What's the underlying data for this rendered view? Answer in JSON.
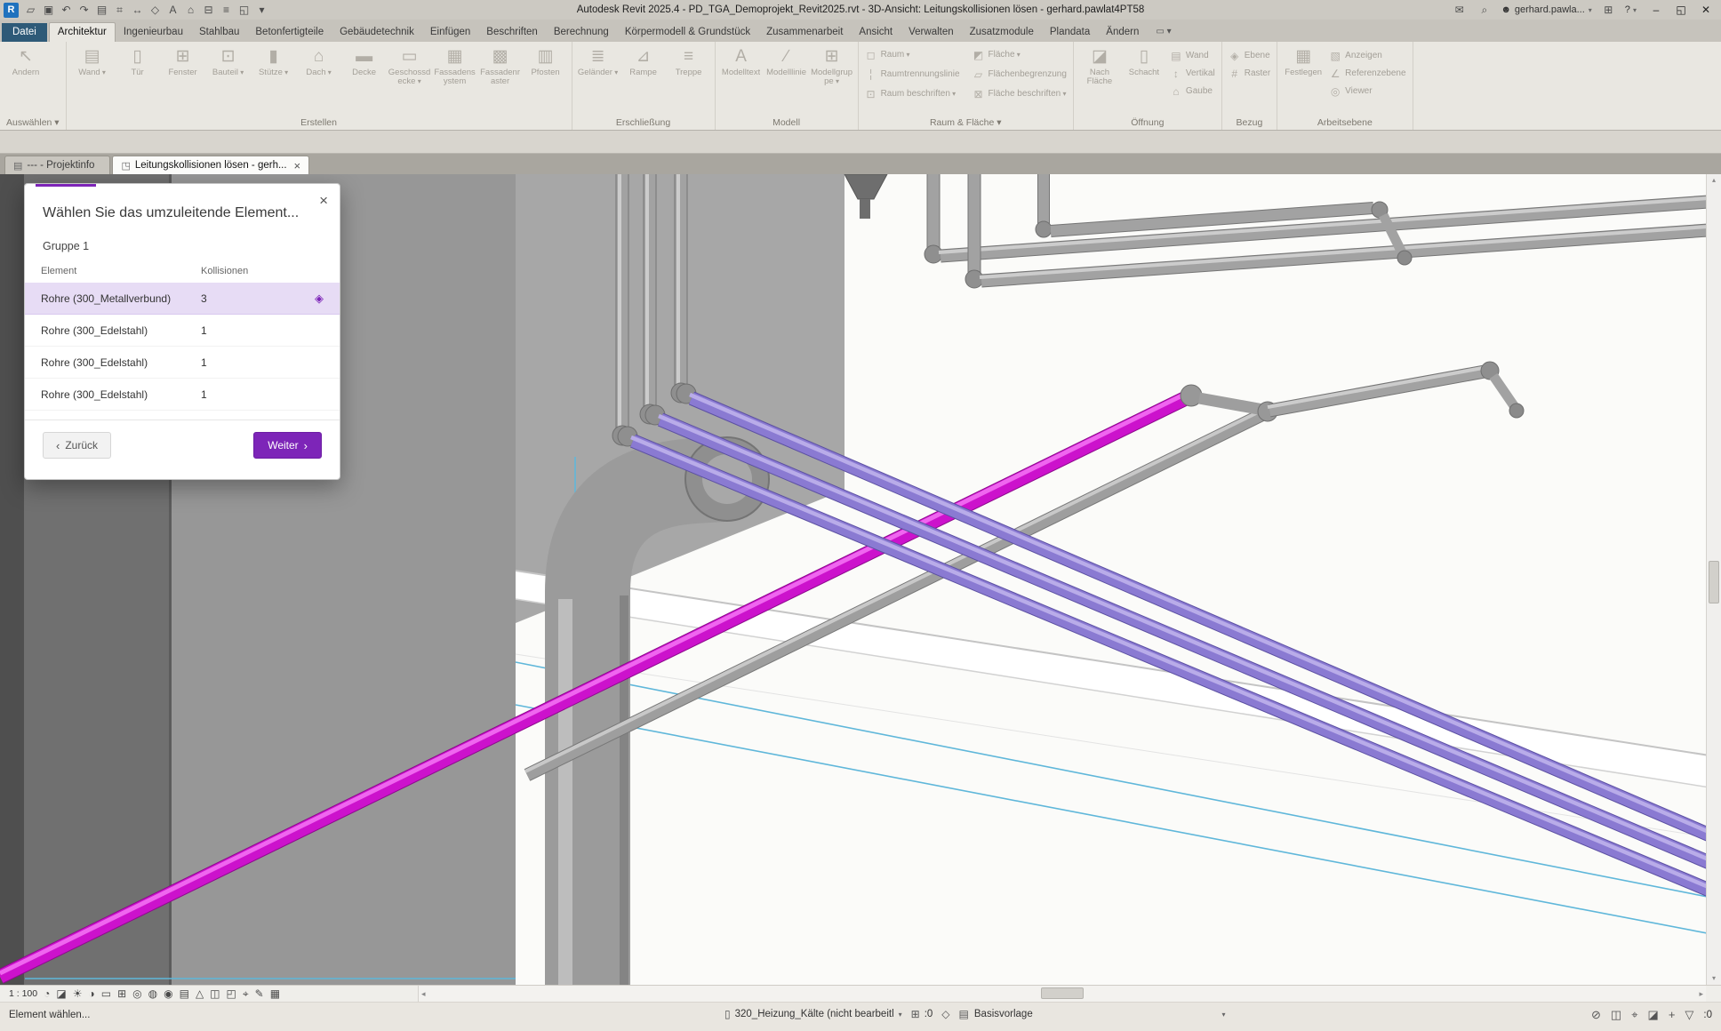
{
  "titlebar": {
    "logo_letter": "R",
    "title": "Autodesk Revit 2025.4 - PD_TGA_Demoprojekt_Revit2025.rvt - 3D-Ansicht: Leitungskollisionen lösen - gerhard.pawlat4PT58",
    "qat": [
      {
        "name": "open-icon",
        "glyph": "▱"
      },
      {
        "name": "save-icon",
        "glyph": "▣"
      },
      {
        "name": "undo-icon",
        "glyph": "↶"
      },
      {
        "name": "redo-icon",
        "glyph": "↷"
      },
      {
        "name": "print-icon",
        "glyph": "▤"
      },
      {
        "name": "measure-icon",
        "glyph": "⌗"
      },
      {
        "name": "aligned-dimension-icon",
        "glyph": "↔"
      },
      {
        "name": "tag-icon",
        "glyph": "◇"
      },
      {
        "name": "text-note-icon",
        "glyph": "A"
      },
      {
        "name": "default-3d-view-icon",
        "glyph": "⌂"
      },
      {
        "name": "section-icon",
        "glyph": "⊟"
      },
      {
        "name": "thin-lines-icon",
        "glyph": "≡"
      },
      {
        "name": "switch-windows-icon",
        "glyph": "◱"
      },
      {
        "name": "customize-qat-icon",
        "glyph": "▾"
      }
    ],
    "mail_glyph": "✉",
    "search_glyph": "⌕",
    "user_glyph": "☻",
    "user_label": "gerhard.pawla...",
    "cart_glyph": "⊞",
    "help_label": "?",
    "dropdown_glyph": "▾",
    "min_glyph": "–",
    "restore_glyph": "◱",
    "close_glyph": "✕"
  },
  "ribbon": {
    "tabs": [
      {
        "label": "Datei",
        "file": true
      },
      {
        "label": "Architektur",
        "active": true
      },
      {
        "label": "Ingenieurbau"
      },
      {
        "label": "Stahlbau"
      },
      {
        "label": "Betonfertigteile"
      },
      {
        "label": "Gebäudetechnik"
      },
      {
        "label": "Einfügen"
      },
      {
        "label": "Beschriften"
      },
      {
        "label": "Berechnung"
      },
      {
        "label": "Körpermodell & Grundstück"
      },
      {
        "label": "Zusammenarbeit"
      },
      {
        "label": "Ansicht"
      },
      {
        "label": "Verwalten"
      },
      {
        "label": "Zusatzmodule"
      },
      {
        "label": "Plandata"
      },
      {
        "label": "Ändern"
      }
    ],
    "toggle_glyph": "▭ ▾",
    "panels": {
      "auswaehlen": {
        "label": "Auswählen ▾",
        "button": {
          "label": "Ändern",
          "glyph": "↖"
        }
      },
      "erstellen": {
        "label": "Erstellen",
        "buttons": [
          {
            "label": "Wand",
            "glyph": "▤",
            "arrow": true
          },
          {
            "label": "Tür",
            "glyph": "▯"
          },
          {
            "label": "Fenster",
            "glyph": "⊞"
          },
          {
            "label": "Bauteil",
            "glyph": "⊡",
            "arrow": true
          },
          {
            "label": "Stütze",
            "glyph": "▮",
            "arrow": true
          },
          {
            "label": "Dach",
            "glyph": "⌂",
            "arrow": true
          },
          {
            "label": "Decke",
            "glyph": "▬"
          },
          {
            "label": "Geschossdecke",
            "glyph": "▭",
            "arrow": true
          },
          {
            "label": "Fassadensystem",
            "glyph": "▦"
          },
          {
            "label": "Fassadenraster",
            "glyph": "▩"
          },
          {
            "label": "Pfosten",
            "glyph": "▥"
          }
        ]
      },
      "erschliessung": {
        "label": "Erschließung",
        "buttons": [
          {
            "label": "Geländer",
            "glyph": "≣",
            "arrow": true
          },
          {
            "label": "Rampe",
            "glyph": "⊿"
          },
          {
            "label": "Treppe",
            "glyph": "≡"
          }
        ]
      },
      "modell": {
        "label": "Modell",
        "buttons": [
          {
            "label": "Modelltext",
            "glyph": "A"
          },
          {
            "label": "Modelllinie",
            "glyph": "∕"
          },
          {
            "label": "Modellgruppe",
            "glyph": "⊞",
            "arrow": true
          }
        ]
      },
      "raumflaeche": {
        "label": "Raum & Fläche ▾",
        "buttons": [
          {
            "label": "Raum",
            "glyph": "◻",
            "arrow": true
          },
          {
            "label": "Raumtrennungslinie",
            "glyph": "╎"
          },
          {
            "label": "Raum beschriften",
            "glyph": "⊡",
            "arrow": true
          },
          {
            "label": "Fläche",
            "glyph": "◩",
            "arrow": true
          },
          {
            "label": "Flächenbegrenzung",
            "glyph": "▱"
          },
          {
            "label": "Fläche beschriften",
            "glyph": "⊠",
            "arrow": true
          }
        ]
      },
      "oeffnung": {
        "label": "Öffnung",
        "big": [
          {
            "label": "Nach Fläche",
            "glyph": "◪"
          },
          {
            "label": "Schacht",
            "glyph": "▯"
          }
        ],
        "small": [
          {
            "label": "Wand",
            "glyph": "▤"
          },
          {
            "label": "Vertikal",
            "glyph": "↕"
          },
          {
            "label": "Gaube",
            "glyph": "⌂"
          }
        ]
      },
      "bezug": {
        "label": "Bezug",
        "buttons": [
          {
            "label": "Ebene",
            "glyph": "◈"
          },
          {
            "label": "Raster",
            "glyph": "#"
          }
        ]
      },
      "arbeitsebene": {
        "label": "Arbeitsebene",
        "big": {
          "label": "Festlegen",
          "glyph": "▦"
        },
        "small": [
          {
            "label": "Anzeigen",
            "glyph": "▧"
          },
          {
            "label": "Referenzebene",
            "glyph": "∠"
          },
          {
            "label": "Viewer",
            "glyph": "◎"
          }
        ]
      }
    }
  },
  "view_tabs": [
    {
      "label": "--- - Projektinfo",
      "glyph": "▤"
    },
    {
      "label": "Leitungskollisionen lösen - gerh...",
      "glyph": "◳",
      "active": true,
      "close_glyph": "×"
    }
  ],
  "dialog": {
    "title": "Wählen Sie das umzuleitende Element...",
    "close_glyph": "×",
    "group": "Gruppe 1",
    "columns": {
      "element": "Element",
      "collisions": "Kollisionen"
    },
    "rows": [
      {
        "element": "Rohre (300_Metallverbund)",
        "collisions": "3",
        "selected": true,
        "icon": "◈"
      },
      {
        "element": "Rohre (300_Edelstahl)",
        "collisions": "1"
      },
      {
        "element": "Rohre (300_Edelstahl)",
        "collisions": "1"
      },
      {
        "element": "Rohre (300_Edelstahl)",
        "collisions": "1"
      }
    ],
    "back_chevron": "‹",
    "back_label": "Zurück",
    "next_label": "Weiter",
    "next_chevron": "›"
  },
  "view_control": {
    "scale": "1 : 100",
    "icons": [
      {
        "name": "detail-level-icon",
        "glyph": "◔"
      },
      {
        "name": "visual-style-icon",
        "glyph": "◪"
      },
      {
        "name": "sun-path-icon",
        "glyph": "☀"
      },
      {
        "name": "shadows-icon",
        "glyph": "◑"
      },
      {
        "name": "crop-view-icon",
        "glyph": "▭"
      },
      {
        "name": "show-crop-region-icon",
        "glyph": "⊞"
      },
      {
        "name": "lock-3d-view-icon",
        "glyph": "◎"
      },
      {
        "name": "temporary-hide-isolate-icon",
        "glyph": "◍"
      },
      {
        "name": "reveal-hidden-elements-icon",
        "glyph": "◉"
      },
      {
        "name": "temporary-view-properties-icon",
        "glyph": "▤"
      },
      {
        "name": "analytical-model-icon",
        "glyph": "△"
      },
      {
        "name": "worksharing-display-icon",
        "glyph": "◫"
      },
      {
        "name": "displacement-icon",
        "glyph": "◰"
      },
      {
        "name": "reveal-constraints-icon",
        "glyph": "⌖"
      },
      {
        "name": "selection-options-icon",
        "glyph": "✎"
      },
      {
        "name": "more-view-options-icon",
        "glyph": "▦"
      }
    ]
  },
  "scroll": {
    "up": "▴",
    "down": "▾",
    "left": "◂",
    "right": "▸"
  },
  "status_bar": {
    "prompt": "Element wählen...",
    "design_option_glyph": "▯",
    "design_option": "320_Heizung_Kälte (nicht bearbeitl",
    "dropdown_glyph": "▾",
    "editable_glyph": "⊞",
    "editable_count": ":0",
    "diamond_glyph": "◇",
    "template_glyph": "▤",
    "view_template": "Basisvorlage",
    "right_icons": [
      {
        "name": "select-links-icon",
        "glyph": "⊘"
      },
      {
        "name": "select-underlay-icon",
        "glyph": "◫"
      },
      {
        "name": "select-pinned-icon",
        "glyph": "⌖"
      },
      {
        "name": "select-by-face-icon",
        "glyph": "◪"
      },
      {
        "name": "drag-on-selection-icon",
        "glyph": "+"
      },
      {
        "name": "filter-icon",
        "glyph": "▽"
      }
    ],
    "filter_count": ":0"
  },
  "colors": {
    "accent_purple": "#7d25b8",
    "selection_row": "#e7dcf5",
    "pipe_magenta": "#cc12cc",
    "pipe_violet": "#8a7ad2",
    "pipe_gray": "#a0a0a0",
    "reference_cyan": "#5fb7da"
  }
}
